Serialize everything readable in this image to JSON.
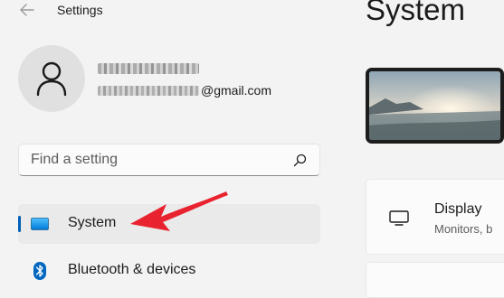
{
  "window": {
    "title": "Settings"
  },
  "account": {
    "name_redacted": "",
    "email_suffix": "@gmail.com"
  },
  "search": {
    "placeholder": "Find a setting",
    "value": ""
  },
  "sidebar": {
    "items": [
      {
        "label": "System",
        "icon": "monitor-icon",
        "selected": true
      },
      {
        "label": "Bluetooth & devices",
        "icon": "bluetooth-icon",
        "selected": false
      }
    ]
  },
  "main": {
    "page_title": "System",
    "cards": [
      {
        "title": "Display",
        "subtitle": "Monitors, b",
        "icon": "display-icon"
      }
    ]
  },
  "colors": {
    "accent": "#005fb8",
    "annotation_arrow": "#e8232f",
    "bluetooth": "#0067c0"
  }
}
